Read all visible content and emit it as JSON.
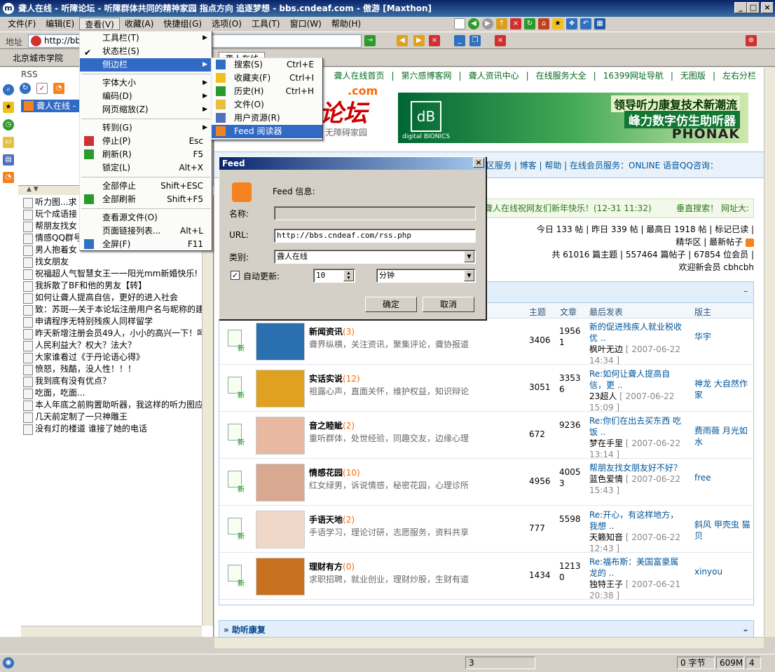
{
  "window": {
    "title": "聋人在线 - 听障论坛 - 听障群体共同的精神家园 指点方向 追逐梦想 - bbs.cndeaf.com - 傲游 [Maxthon]"
  },
  "menubar": [
    "文件(F)",
    "编辑(E)",
    "查看(V)",
    "收藏(A)",
    "快捷组(G)",
    "选项(O)",
    "工具(T)",
    "窗口(W)",
    "帮助(H)"
  ],
  "address": {
    "label": "地址",
    "value": "http://bbs"
  },
  "tabs": [
    "北京城市学院",
    "聋人在线"
  ],
  "sidebar": {
    "title": "RSS",
    "feed": "聋人在线 - ",
    "items": [
      "听力图...求",
      "玩个成语接",
      "帮朋友找女",
      "情感QQ群号",
      "男人抱着女",
      "找女朋友",
      "祝福超人气智慧女王一一阳光mm新婚快乐!",
      "我拆散了BF和他的男友【转】",
      "如何让聋人提高自信，更好的进入社会",
      "致：苏斑---关于本论坛注册用户名与昵称的建议",
      "申请程序无特别残疾人同样留学",
      "昨天新增注册会员49人，小小的高兴一下！呵呵",
      "人民利益大？权大？法大？",
      "大家谁看过《于丹论语心得》",
      "愤怒，残酷，没人性！！！",
      "我到底有没有优点？",
      "吃面，吃面...",
      "本人年底之前购置助听器，我这样的听力图应配",
      "几天前定制了一只神雕王",
      "没有灯的楼道 谁接了她的电话"
    ]
  },
  "view_menu": [
    {
      "label": "工具栏(T)",
      "shortcut": "",
      "arrow": true
    },
    {
      "label": "状态栏(S)",
      "shortcut": "",
      "check": true
    },
    {
      "label": "侧边栏",
      "shortcut": "",
      "arrow": true,
      "highlight": true
    },
    {
      "sep": true
    },
    {
      "label": "字体大小",
      "shortcut": "",
      "arrow": true
    },
    {
      "label": "编码(D)",
      "shortcut": "",
      "arrow": true
    },
    {
      "label": "网页缩放(Z)",
      "shortcut": "",
      "arrow": true
    },
    {
      "sep": true
    },
    {
      "label": "转到(G)",
      "shortcut": "",
      "arrow": true
    },
    {
      "label": "停止(P)",
      "shortcut": "Esc"
    },
    {
      "label": "刷新(R)",
      "shortcut": "F5"
    },
    {
      "label": "锁定(L)",
      "shortcut": "Alt+X"
    },
    {
      "sep": true
    },
    {
      "label": "全部停止",
      "shortcut": "Shift+ESC"
    },
    {
      "label": "全部刷新",
      "shortcut": "Shift+F5"
    },
    {
      "sep": true
    },
    {
      "label": "查看源文件(O)",
      "shortcut": ""
    },
    {
      "label": "页面链接列表...",
      "shortcut": "Alt+L"
    },
    {
      "label": "全屏(F)",
      "shortcut": "F11"
    }
  ],
  "sidebar_menu": [
    {
      "label": "搜索(S)",
      "shortcut": "Ctrl+E"
    },
    {
      "label": "收藏夹(F)",
      "shortcut": "Ctrl+I"
    },
    {
      "label": "历史(H)",
      "shortcut": "Ctrl+H"
    },
    {
      "label": "文件(O)",
      "shortcut": ""
    },
    {
      "label": "用户资源(R)",
      "shortcut": ""
    },
    {
      "label": "Feed 阅读器",
      "shortcut": "",
      "highlight": true
    }
  ],
  "dialog": {
    "title": "Feed",
    "info_label": "Feed 信息:",
    "name_label": "名称:",
    "name_value": "",
    "url_label": "URL:",
    "url_value": "http://bbs.cndeaf.com/rss.php",
    "category_label": "类别:",
    "category_value": "聋人在线",
    "auto_update_label": "自动更新:",
    "interval_value": "10",
    "unit_value": "分钟",
    "ok": "确定",
    "cancel": "取消"
  },
  "page": {
    "navlinks": [
      "聋人在线首页",
      "第六感博客网",
      "聋人资讯中心",
      "在线服务大全",
      "16399网址导航",
      "无图版",
      "左右分栏"
    ],
    "logo_text": "论坛",
    "logo_domain": ".com",
    "logo_sub": "无障碍家园",
    "banner": {
      "line1": "领导听力康复技术新潮流",
      "line2": "峰力数字仿生助听器",
      "line3": "PHONAK",
      "brand": "digital BIONICS"
    },
    "bluebar": "区服务 | 博客 | 帮助 | 在线会员服务：ONLINE 语音QQ咨询：",
    "greenbar_left": "聋人在线祝网友们新年快乐！(12-31 11:32)",
    "greenbar_right": "垂直搜索！ 网址大:",
    "stats_line1": "今日 133 帖 | 昨日 339 帖 | 最高日 1918 帖 | 标记已读 |",
    "stats_line2": "精华区 | 最新帖子",
    "stats_line3": "共 61016 篇主题 | 557464 篇帖子 | 67854 位会员 |",
    "stats_line4": "欢迎新会员 cbhcbh",
    "columns": [
      "主题",
      "文章",
      "最后发表",
      "版主"
    ],
    "forums": [
      {
        "name": "新闻资讯",
        "count": "(3)",
        "desc": "聋界纵横，关注资讯，聚集评论，聋协报道",
        "topics": "3406",
        "posts": "19561",
        "last_title": "新的促进残疾人就业税收优 ..",
        "last_user": "枫叶无边",
        "last_date": "[ 2007-06-22 14:34 ]",
        "mods": "华宇",
        "thumb": "#2a6fb0"
      },
      {
        "name": "实话实说",
        "count": "(12)",
        "desc": "祖露心声，直面关怀，维护权益，知识辩论",
        "topics": "3051",
        "posts": "33536",
        "last_title": "Re:如何让聋人提高自信，更 ..",
        "last_user": "23超人",
        "last_date": "[ 2007-06-22 15:09 ]",
        "mods": "神龙 大自然作家",
        "thumb": "#e0a020"
      },
      {
        "name": "音之睦眦",
        "count": "(2)",
        "desc": "重听群体，处世经验，同趣交友，边缘心理",
        "topics": "672",
        "posts": "9236",
        "last_title": "Re:你们在出去买东西 吃饭 ..",
        "last_user": "梦在手里",
        "last_date": "[ 2007-06-22 13:14 ]",
        "mods": "费雨薇 月光如水",
        "thumb": "#e8b8a0"
      },
      {
        "name": "情感花园",
        "count": "(10)",
        "desc": "红女绿男，诉说情感，秘密花园，心理诊所",
        "topics": "4956",
        "posts": "40053",
        "last_title": "帮朋友找女朋友好不好？",
        "last_user": "蓝色爱情",
        "last_date": "[ 2007-06-22 15:43 ]",
        "mods": "free",
        "thumb": "#d8a890"
      },
      {
        "name": "手语天地",
        "count": "(2)",
        "desc": "手语学习，理论讨研，志愿服务，资料共享",
        "topics": "777",
        "posts": "5598",
        "last_title": "Re:开心，有这样地方，我想 ..",
        "last_user": "天籁知音",
        "last_date": "[ 2007-06-22 12:43 ]",
        "mods": "斜风 甲壳虫 猫贝",
        "thumb": "#f0d8c8"
      },
      {
        "name": "理财有方",
        "count": "(0)",
        "desc": "求职招聘，就业创业，理财炒股，生财有道",
        "topics": "1434",
        "posts": "12130",
        "last_title": "Re:福布斯：美国富豪属龙的 ..",
        "last_user": "独特王子",
        "last_date": "[ 2007-06-21 20:38 ]",
        "mods": "xinyou",
        "thumb": "#c87020"
      }
    ],
    "section2": "» 助听康复"
  },
  "statusbar": {
    "bytes": "0 字节",
    "mem": "609M",
    "num": "4",
    "count": "3"
  }
}
